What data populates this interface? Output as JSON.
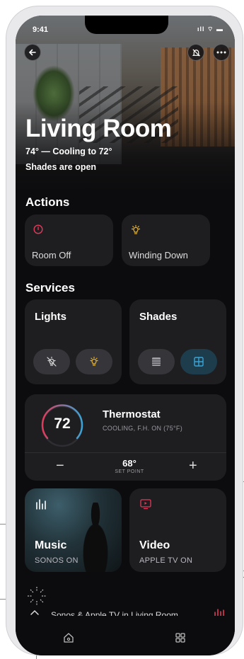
{
  "status_bar": {
    "time": "9:41",
    "signal": "ıll ⌔ ▬"
  },
  "room": {
    "title": "Living Room",
    "subtitle_line1": "74° — Cooling to 72°",
    "subtitle_line2": "Shades are open"
  },
  "actions": {
    "section_title": "Actions",
    "items": [
      {
        "label": "Room Off",
        "icon": "power-icon",
        "color": "#e23a5a"
      },
      {
        "label": "Winding Down",
        "icon": "sunset-bulb-icon",
        "color": "#f2b61f"
      }
    ]
  },
  "services": {
    "section_title": "Services",
    "lights": {
      "title": "Lights",
      "off_icon": "light-off-icon",
      "on_icon": "light-on-icon",
      "on_color": "#f2b61f"
    },
    "shades": {
      "title": "Shades",
      "closed_icon": "shade-closed-icon",
      "open_icon": "shade-open-icon",
      "open_color": "#3aa4d6"
    }
  },
  "thermostat": {
    "current": "72",
    "name": "Thermostat",
    "status": "COOLING, F.H. ON (75°F)",
    "setpoint": "68°",
    "setpoint_label": "SET POINT",
    "minus": "−",
    "plus": "+"
  },
  "media": {
    "music": {
      "title": "Music",
      "subtitle": "SONOS ON",
      "icon": "equalizer-icon"
    },
    "video": {
      "title": "Video",
      "subtitle": "APPLE TV ON",
      "icon": "tv-play-icon",
      "color": "#e23a5a"
    }
  },
  "now_playing": {
    "text": "Sonos & Apple TV in Living Room",
    "accent": "#e23a5a"
  },
  "tabbar": {
    "home_icon": "home-icon",
    "grid_icon": "grid-icon"
  }
}
